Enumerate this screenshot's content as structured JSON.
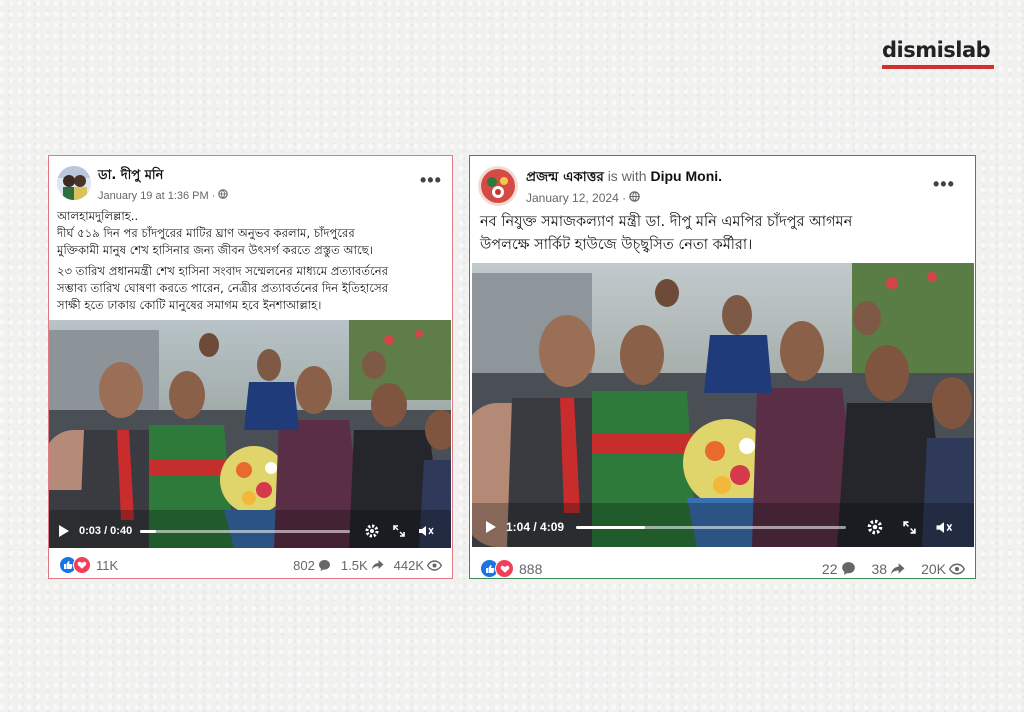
{
  "brand": {
    "logo_text": "dismislab",
    "accent": "#d62d2d"
  },
  "left_post": {
    "author": "ডা. দীপু মনি",
    "date": "January 19 at 1:36 PM",
    "privacy_icon": "globe-icon",
    "paragraph1_lines": [
      "আলহামদুলিল্লাহ..",
      "দীর্ঘ ৫১৯ দিন পর চাঁদপুরের মাটির ঘ্রাণ অনুভব করলাম, চাঁদপুরের",
      "মুক্তিকামী মানুষ শেখ হাসিনার জন্য জীবন উৎসর্গ করতে প্রস্তুত আছে।"
    ],
    "paragraph2_lines": [
      "২৩ তারিখ প্রধানমন্ত্রী শেখ হাসিনা সংবাদ সম্মেলনের মাধ্যমে প্রত্যাবর্তনের",
      "সম্ভাব্য তারিখ ঘোষণা করতে পারেন, নেত্রীর প্রত্যাবর্তনের দিন ইতিহাসের",
      "সাক্ষী হতে ঢাকায় কোটি মানুষের সমাগম হবে ইনশাআল্লাহ।"
    ],
    "video": {
      "time": "0:03 / 0:40",
      "progress": 0.075
    },
    "reactions": "11K",
    "comments": "802",
    "shares": "1.5K",
    "views": "442K",
    "border_color": "#e07b86"
  },
  "right_post": {
    "author": "প্রজন্ম একাত্তর",
    "with_text": "is with",
    "tagged": "Dipu Moni",
    "date": "January 12, 2024",
    "privacy_icon": "globe-icon",
    "text_lines": [
      "নব নিযুক্ত সমাজকল্যাণ মন্ত্রী ডা. দীপু মনি এমপির চাঁদপুর আগমন",
      "উপলক্ষে সার্কিট হাউজে উচ্ছ্বসিত নেতা কর্মীরা।"
    ],
    "video": {
      "time": "1:04 / 4:09",
      "progress": 0.257
    },
    "reactions": "888",
    "comments": "22",
    "shares": "38",
    "views": "20K",
    "border_color": "#3c8a55"
  }
}
